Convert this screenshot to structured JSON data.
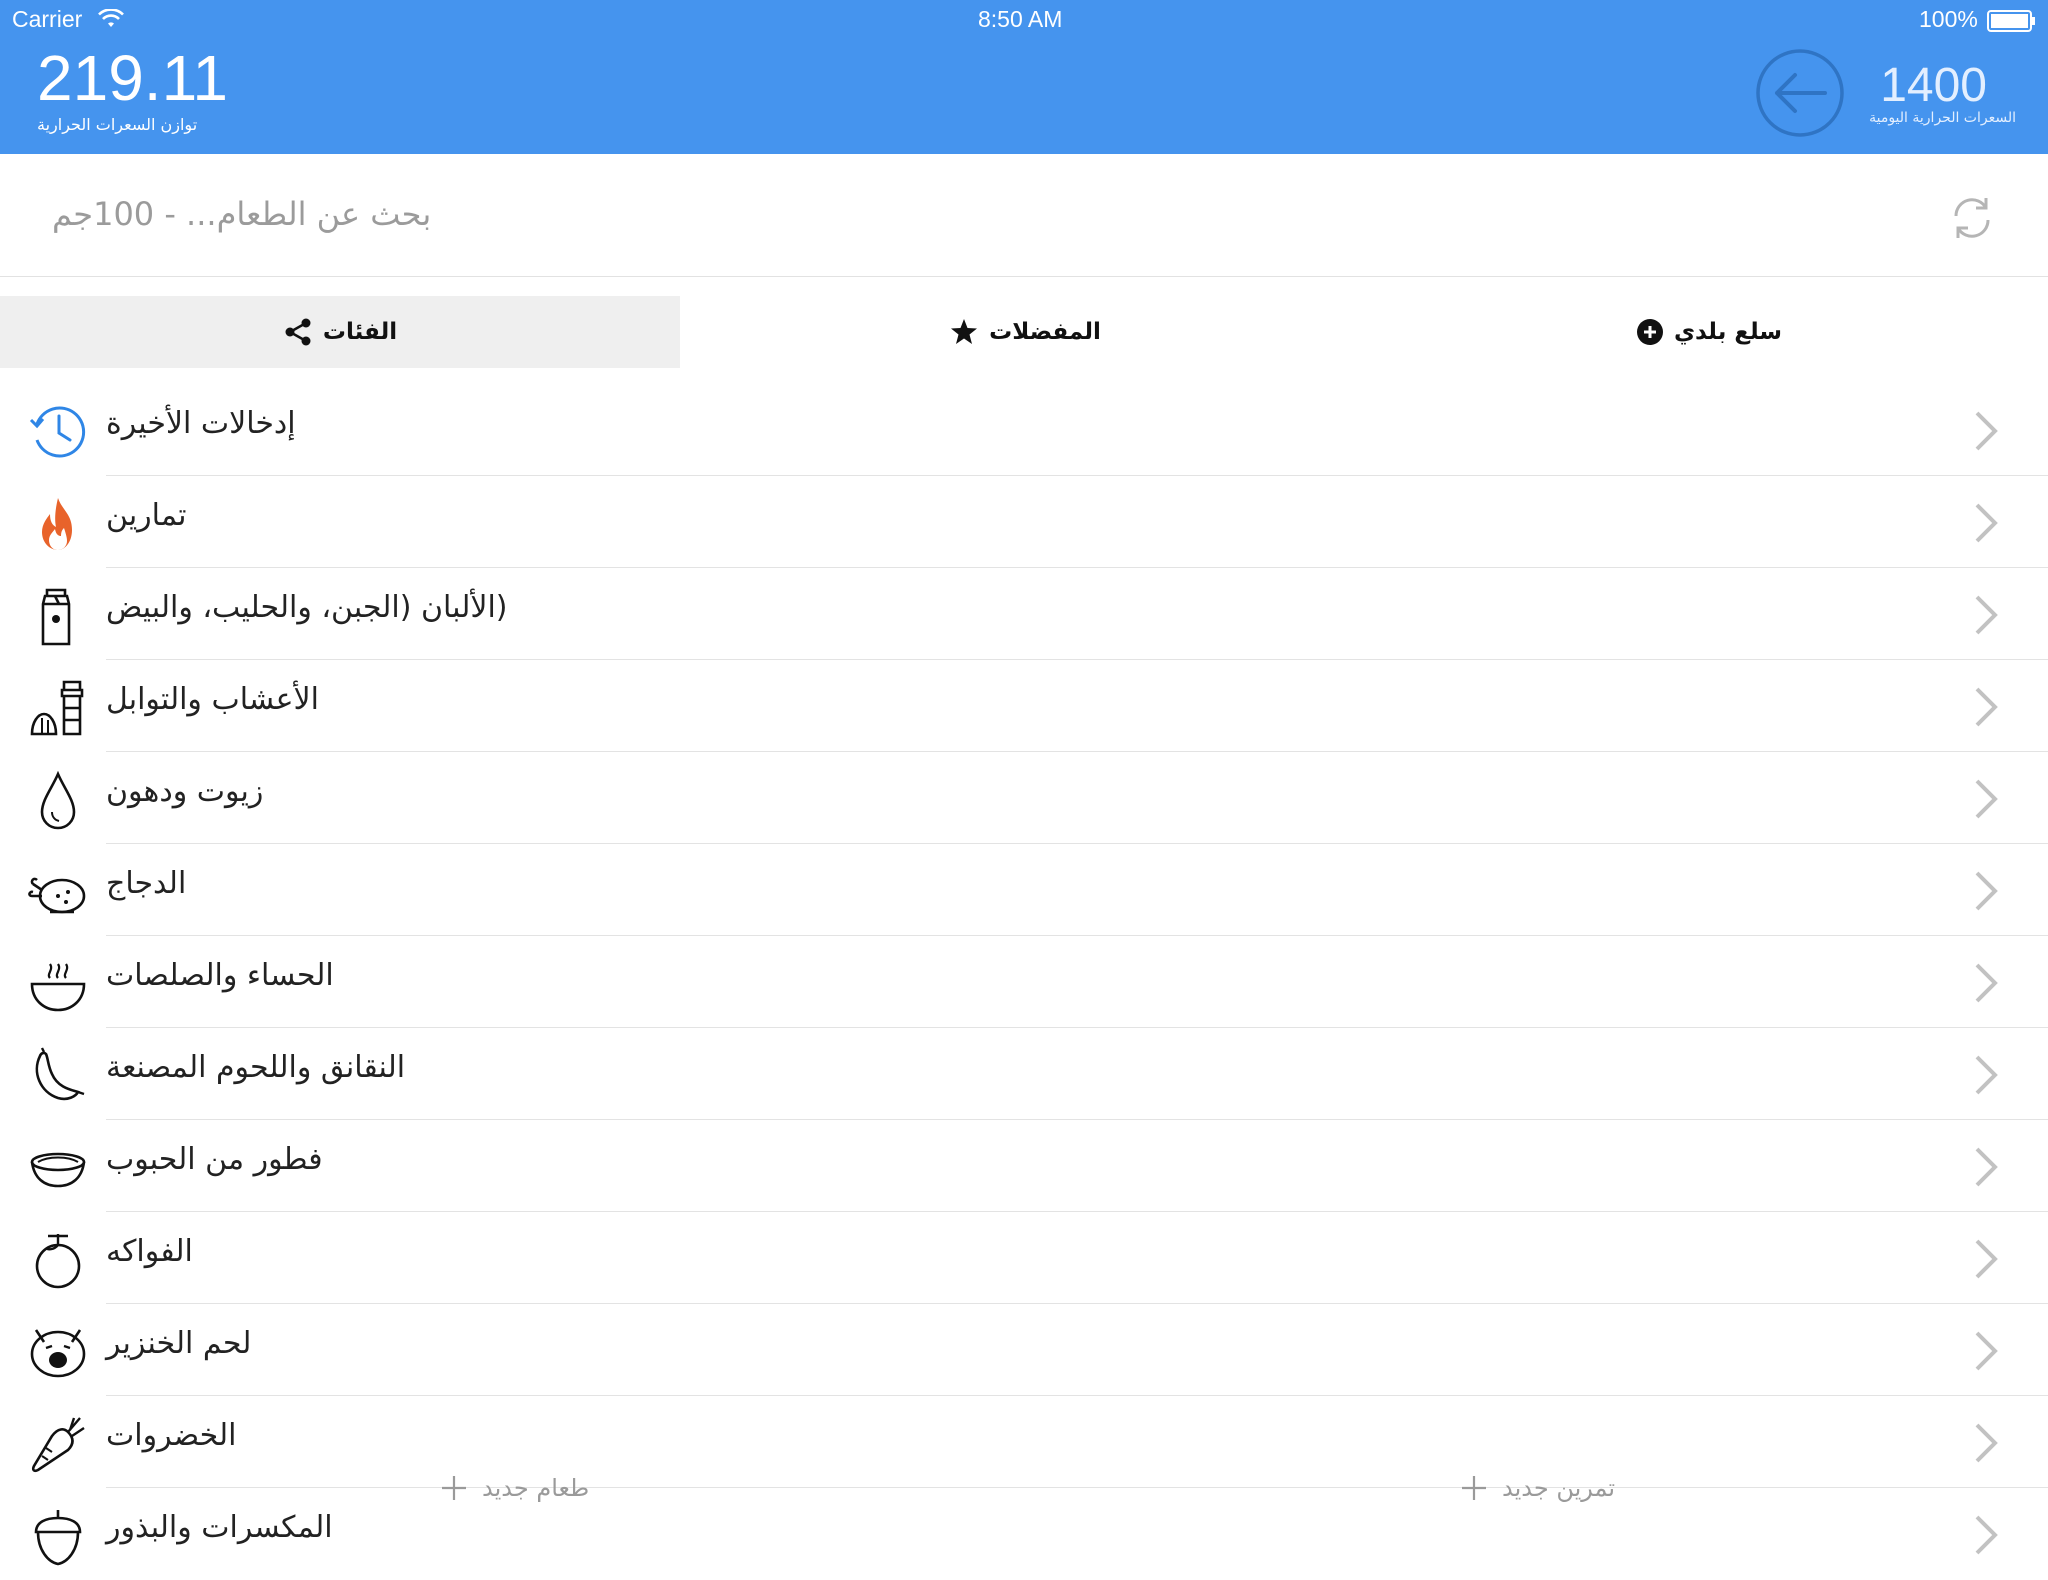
{
  "status_bar": {
    "carrier": "Carrier",
    "time": "8:50 AM",
    "battery": "100%"
  },
  "header": {
    "balance_value": "219.11",
    "balance_label": "توازن السعرات الحرارية",
    "daily_value": "1400",
    "daily_label": "السعرات الحرارية اليومية"
  },
  "search": {
    "placeholder": "بحث عن الطعام... - 100جم"
  },
  "tabs": [
    {
      "label": "الفئات",
      "icon": "share-icon",
      "active": true
    },
    {
      "label": "المفضلات",
      "icon": "star-icon",
      "active": false
    },
    {
      "label": "سلع بلدي",
      "icon": "plus-circle-icon",
      "active": false
    }
  ],
  "categories": [
    {
      "label": "إدخالات الأخيرة",
      "icon": "history-clock-icon"
    },
    {
      "label": "تمارين",
      "icon": "flame-icon"
    },
    {
      "label": "(الألبان (الجبن، والحليب، والبيض",
      "icon": "milk-carton-icon"
    },
    {
      "label": "الأعشاب والتوابل",
      "icon": "spice-grinder-icon"
    },
    {
      "label": "زيوت ودهون",
      "icon": "oil-drop-icon"
    },
    {
      "label": "الدجاج",
      "icon": "roast-chicken-icon"
    },
    {
      "label": "الحساء والصلصات",
      "icon": "soup-bowl-icon"
    },
    {
      "label": "النقانق واللحوم المصنعة",
      "icon": "sausage-icon"
    },
    {
      "label": "فطور من الحبوب",
      "icon": "cereal-bowl-icon"
    },
    {
      "label": "الفواكه",
      "icon": "fruit-icon"
    },
    {
      "label": "لحم الخنزير",
      "icon": "pig-icon"
    },
    {
      "label": "الخضروات",
      "icon": "carrot-icon"
    },
    {
      "label": "المكسرات والبذور",
      "icon": "acorn-icon"
    }
  ],
  "footer": {
    "new_food": "طعام جديد",
    "new_exercise": "تمرين جديد"
  },
  "colors": {
    "header_bg": "#4594ee",
    "flame": "#e8632b",
    "history_blue": "#2f86e6"
  }
}
